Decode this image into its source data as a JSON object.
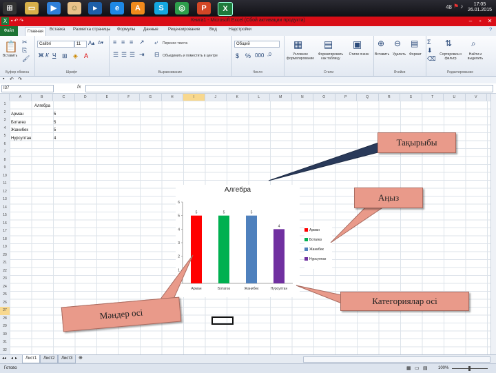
{
  "taskbar": {
    "tray_text": "48",
    "clock_time": "17:05",
    "clock_date": "26.01.2015"
  },
  "window": {
    "title": "Книга1 - Microsoft Excel (Сбой активации продукта)",
    "app_icon_letter": "X"
  },
  "ribbon_tabs": [
    "Файл",
    "Главная",
    "Вставка",
    "Разметка страницы",
    "Формулы",
    "Данные",
    "Рецензирование",
    "Вид",
    "Надстройки"
  ],
  "ribbon": {
    "paste_label": "Вставить",
    "font_name": "Calibri",
    "font_size": "11",
    "wrap_text": "Перенос текста",
    "merge_center": "Объединить и поместить в центре",
    "number_format": "Общий",
    "cond_format": "Условное форматирование",
    "format_table": "Форматировать как таблицу",
    "cell_styles": "Стили ячеек",
    "insert_cells": "Вставить",
    "delete_cells": "Удалить",
    "format_cells": "Формат",
    "sort_filter": "Сортировка и фильтр",
    "find_select": "Найти и выделить",
    "group_clipboard": "Буфер обмена",
    "group_font": "Шрифт",
    "group_alignment": "Выравнивание",
    "group_number": "Число",
    "group_styles": "Стили",
    "group_cells": "Ячейки",
    "group_editing": "Редактирование"
  },
  "formula_bar": {
    "name_box": "I37",
    "fx": "fx",
    "formula": ""
  },
  "columns": [
    "A",
    "B",
    "C",
    "D",
    "E",
    "F",
    "G",
    "H",
    "I",
    "J",
    "K",
    "L",
    "M",
    "N",
    "O",
    "P",
    "Q",
    "R",
    "S",
    "T",
    "U",
    "V"
  ],
  "selected_column": "I",
  "rows": [
    "1",
    "2",
    "3",
    "4",
    "5",
    "6",
    "7",
    "8",
    "9",
    "10",
    "11",
    "12",
    "13",
    "14",
    "15",
    "16",
    "17",
    "18",
    "19",
    "20",
    "21",
    "22",
    "23",
    "24",
    "25",
    "26",
    "27",
    "28",
    "29",
    "30",
    "31",
    "32"
  ],
  "selected_row": "27",
  "cells": {
    "b1": "Алгебра",
    "a2": "Арман",
    "b2": "5",
    "a3": "Ботагөз",
    "b3": "5",
    "a4": "Жанибек",
    "b4": "5",
    "a5": "Нурсултан",
    "b5": "4"
  },
  "sheet_tabs": [
    "Лист1",
    "Лист2",
    "Лист3"
  ],
  "status": {
    "ready": "Готово",
    "zoom": "100%"
  },
  "chart_data": {
    "type": "bar",
    "title": "Алгебра",
    "categories": [
      "Арман",
      "Ботагөз",
      "Жанибек",
      "Нурсултан"
    ],
    "values": [
      5,
      5,
      5,
      4
    ],
    "colors": [
      "#ff0000",
      "#00b050",
      "#4f81bd",
      "#7030a0"
    ],
    "ylim": [
      0,
      6
    ],
    "yticks": [
      0,
      1,
      2,
      3,
      4,
      5,
      6
    ],
    "data_labels": true,
    "legend": "right",
    "grid": false
  },
  "callouts": {
    "title_label": "Тақырыбы",
    "legend_label": "Аңыз",
    "values_label": "Мәндер осі",
    "categories_label": "Категориялар осі",
    "color": "#e99a8a"
  }
}
